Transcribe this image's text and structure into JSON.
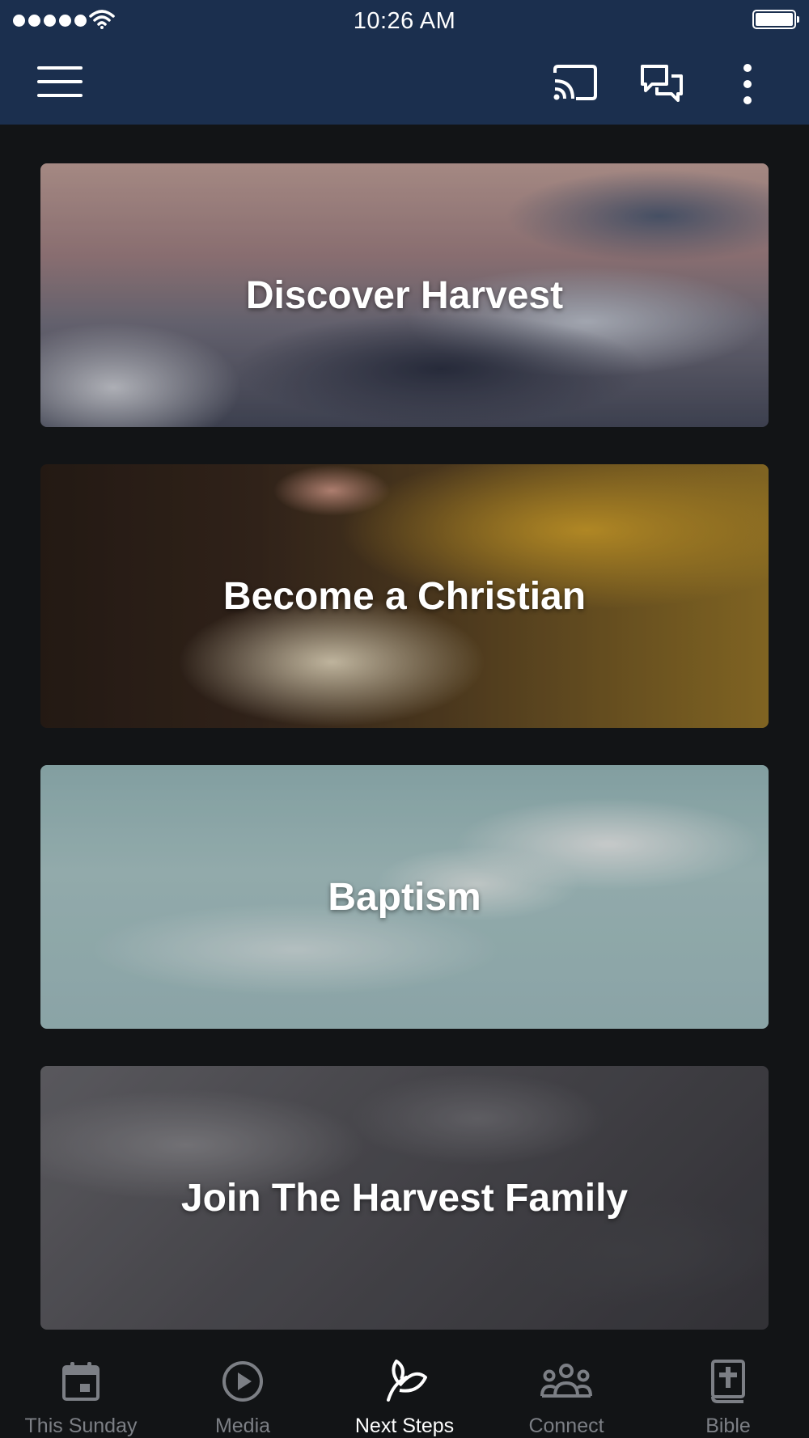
{
  "status_bar": {
    "time": "10:26 AM"
  },
  "header": {
    "menu_icon": "hamburger-menu-icon",
    "cast_icon": "cast-icon",
    "chat_icon": "chat-bubbles-icon",
    "more_icon": "more-vertical-icon"
  },
  "cards": [
    {
      "title": "Discover Harvest"
    },
    {
      "title": "Become a Christian"
    },
    {
      "title": "Baptism"
    },
    {
      "title": "Join The Harvest Family"
    }
  ],
  "tabs": [
    {
      "label": "This Sunday",
      "icon": "calendar-icon"
    },
    {
      "label": "Media",
      "icon": "play-circle-icon"
    },
    {
      "label": "Next Steps",
      "icon": "leaf-icon",
      "active": true
    },
    {
      "label": "Connect",
      "icon": "people-group-icon"
    },
    {
      "label": "Bible",
      "icon": "bible-cross-icon"
    }
  ],
  "colors": {
    "header_bg": "#1b2f4e",
    "page_bg": "#121416",
    "tab_inactive": "#7c7f85",
    "tab_active": "#ffffff"
  }
}
